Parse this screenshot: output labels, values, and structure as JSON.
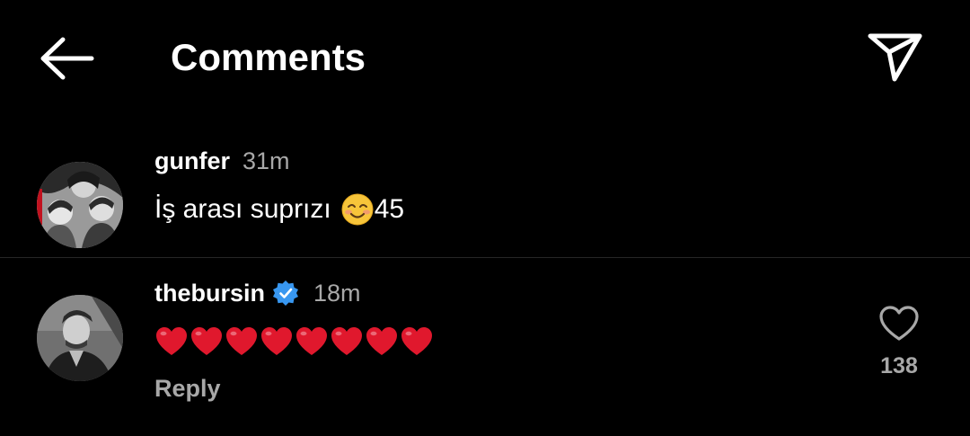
{
  "header": {
    "title": "Comments",
    "back_icon": "arrow-left-icon",
    "send_icon": "paper-plane-icon"
  },
  "comments": [
    {
      "username": "gunfer",
      "time": "31m",
      "text": "İş arası suprızı",
      "emoji": "smiling-face-icon",
      "suffix": "45"
    },
    {
      "username": "thebursin",
      "verified": true,
      "time": "18m",
      "hearts": 8,
      "reply_label": "Reply",
      "like_icon": "heart-outline-icon",
      "like_count": "138"
    }
  ],
  "colors": {
    "background": "#000000",
    "text": "#ffffff",
    "muted": "#a8a8a8",
    "verified": "#3897f0",
    "heart": "#e0182d",
    "divider": "#262626"
  }
}
